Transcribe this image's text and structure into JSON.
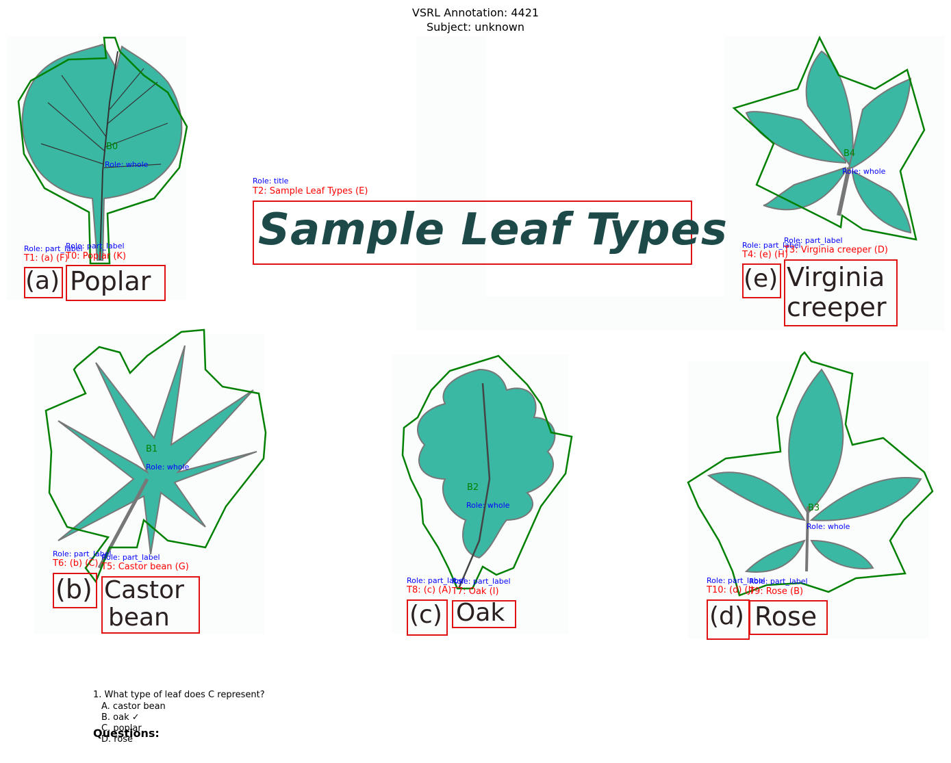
{
  "header": {
    "title_line1": "VSRL Annotation: 4421",
    "title_line2": "Subject: unknown"
  },
  "labels": {
    "B0": "B0",
    "B1": "B1",
    "B2": "B2",
    "B3": "B3",
    "B4": "B4",
    "role_whole": "Role: whole",
    "role_part_label": "Role: part_label",
    "role_title": "Role: title",
    "T0": "T0: Poplar (K)",
    "T1": "T1: (a) (F)",
    "T2": "T2: Sample Leaf Types (E)",
    "T3": "T3: Virginia creeper (D)",
    "T4": "T4: (e) (H)",
    "T5": "T5: Castor bean (G)",
    "T6": "T6: (b) (C)",
    "T7": "T7: Oak (I)",
    "T8": "T8: (c) (A)",
    "T9": "T9: Rose (B)",
    "T10": "T10: (d) (J)"
  },
  "image_text": {
    "title": "Sample Leaf Types",
    "a": "(a)",
    "poplar": "Poplar",
    "b": "(b)",
    "castor1": "Castor",
    "castor2": "bean",
    "c": "(c)",
    "oak": "Oak",
    "d": "(d)",
    "rose": "Rose",
    "e": "(e)",
    "virginia1": "Virginia",
    "virginia2": "creeper"
  },
  "questions": {
    "title": "Questions:",
    "q1": "1. What type of leaf does C represent?",
    "optA": "A. castor bean",
    "optB": "B. oak ✓",
    "optC": "C. poplar",
    "optD": "D. rose"
  },
  "colors": {
    "leaf": "#3bb8a4",
    "leaf_outline": "#008000",
    "text_box": "#e01010",
    "role_text": "#0000ff",
    "t_label": "#ff0000"
  }
}
